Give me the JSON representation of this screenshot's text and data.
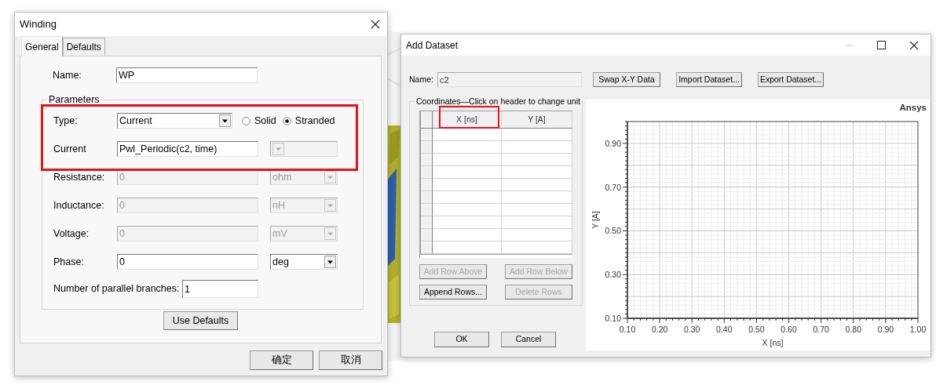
{
  "winding_dialog": {
    "title": "Winding",
    "tabs": [
      {
        "label": "General",
        "selected": true
      },
      {
        "label": "Defaults",
        "selected": false
      }
    ],
    "name": {
      "label": "Name:",
      "value": "WP"
    },
    "parameters": {
      "legend": "Parameters",
      "type": {
        "label": "Type:",
        "value": "Current"
      },
      "radios": [
        {
          "label": "Solid",
          "selected": false
        },
        {
          "label": "Stranded",
          "selected": true
        }
      ],
      "fields": [
        {
          "label": "Current",
          "value": "Pwl_Periodic(c2, time)",
          "disabled": false,
          "unit_disabled": true
        },
        {
          "label": "Resistance:",
          "value": "0",
          "disabled": true,
          "unit": "ohm",
          "unit_disabled": true
        },
        {
          "label": "Inductance:",
          "value": "0",
          "disabled": true,
          "unit": "nH",
          "unit_disabled": true
        },
        {
          "label": "Voltage:",
          "value": "0",
          "disabled": true,
          "unit": "mV",
          "unit_disabled": true
        },
        {
          "label": "Phase:",
          "value": "0",
          "disabled": false,
          "unit": "deg",
          "unit_disabled": false
        }
      ],
      "branches": {
        "label": "Number of parallel branches:",
        "value": "1"
      }
    },
    "use_defaults": "Use Defaults",
    "buttons": [
      "确定",
      "取消"
    ]
  },
  "dataset_dialog": {
    "title": "Add Dataset",
    "name": {
      "label": "Name:",
      "value": "c2"
    },
    "buttons": [
      "Swap X-Y Data",
      "Import Dataset...",
      "Export Dataset..."
    ],
    "coordinates": {
      "legend": "Coordinates—Click on header to change unit",
      "columns": [
        "X [ns]",
        "Y [A]"
      ],
      "row_buttons": [
        {
          "label": "Add Row Above",
          "disabled": true
        },
        {
          "label": "Add Row Below",
          "disabled": true
        },
        {
          "label": "Append Rows...",
          "disabled": false
        },
        {
          "label": "Delete Rows",
          "disabled": true
        }
      ]
    },
    "chart": {
      "chart_data": {
        "type": "line",
        "grid": true,
        "title": "Ansys",
        "xlabel": "X [ns]",
        "ylabel": "Y [A]",
        "xlim": [
          0.1,
          1.0
        ],
        "ylim": [
          0.1,
          1.0
        ],
        "xticks": [
          {
            "value": 0.1,
            "label": "0.10"
          },
          {
            "value": 0.2,
            "label": "0.20"
          },
          {
            "value": 0.3,
            "label": "0.30"
          },
          {
            "value": 0.4,
            "label": "0.40"
          },
          {
            "value": 0.5,
            "label": "0.50"
          },
          {
            "value": 0.6,
            "label": "0.60"
          },
          {
            "value": 0.7,
            "label": "0.70"
          },
          {
            "value": 0.8,
            "label": "0.80"
          },
          {
            "value": 0.9,
            "label": "0.90"
          },
          {
            "value": 1.0,
            "label": "1.00"
          }
        ],
        "yticks": [
          {
            "value": 0.1,
            "label": "0.10"
          },
          {
            "value": 0.3,
            "label": "0.30"
          },
          {
            "value": 0.5,
            "label": "0.50"
          },
          {
            "value": 0.7,
            "label": "0.70"
          },
          {
            "value": 0.9,
            "label": "0.90"
          }
        ]
      }
    },
    "footer_buttons": [
      "OK",
      "Cancel"
    ]
  }
}
